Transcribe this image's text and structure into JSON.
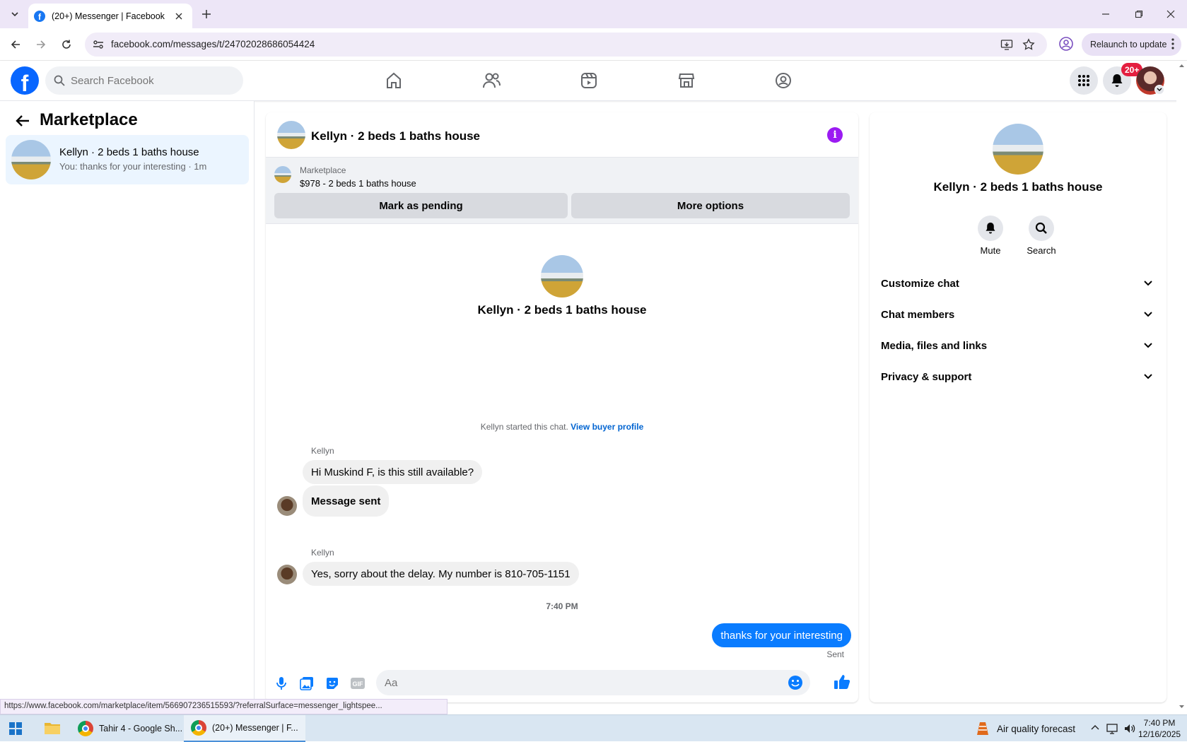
{
  "browser": {
    "tab_title": "(20+) Messenger | Facebook",
    "url": "facebook.com/messages/t/24702028686054424",
    "relaunch_label": "Relaunch to update",
    "status_url": "https://www.facebook.com/marketplace/item/566907236515593/?referralSurface=messenger_lightspee..."
  },
  "fb": {
    "search_placeholder": "Search Facebook",
    "notification_badge": "20+"
  },
  "left": {
    "title": "Marketplace",
    "conversation": {
      "name": "Kellyn · 2 beds 1 baths house",
      "preview": "You: thanks for your interesting · 1m"
    }
  },
  "chat": {
    "title": "Kellyn · 2 beds 1 baths house",
    "marketplace_label": "Marketplace",
    "item": "$978 - 2 beds 1 baths house",
    "mark_pending": "Mark as pending",
    "more_options": "More options",
    "hero_name": "Kellyn · 2 beds 1 baths house",
    "started_text": "Kellyn started this chat.",
    "view_buyer": "View buyer profile",
    "messages": [
      {
        "sender": "Kellyn",
        "text": "Hi Muskind F, is this still available?"
      },
      {
        "text": "Message sent"
      },
      {
        "sender": "Kellyn",
        "text": "Yes, sorry about the delay. My number is 810-705-1151"
      }
    ],
    "timestamp": "7:40 PM",
    "my_message": "thanks for your interesting",
    "sent_status": "Sent",
    "composer_placeholder": "Aa",
    "info_glyph": "i"
  },
  "right": {
    "name": "Kellyn · 2 beds 1 baths house",
    "mute": "Mute",
    "search": "Search",
    "sections": [
      "Customize chat",
      "Chat members",
      "Media, files and links",
      "Privacy & support"
    ]
  },
  "taskbar": {
    "app1": "Tahir 4 - Google Sh...",
    "app2": "(20+) Messenger | F...",
    "weather": "Air quality forecast",
    "time": "7:40 PM",
    "date": "12/16/2025"
  },
  "colors": {
    "accent": "#0a7cff",
    "info": "#9b1bf2",
    "fb_blue": "#0866ff",
    "badge": "#e41e3f"
  }
}
